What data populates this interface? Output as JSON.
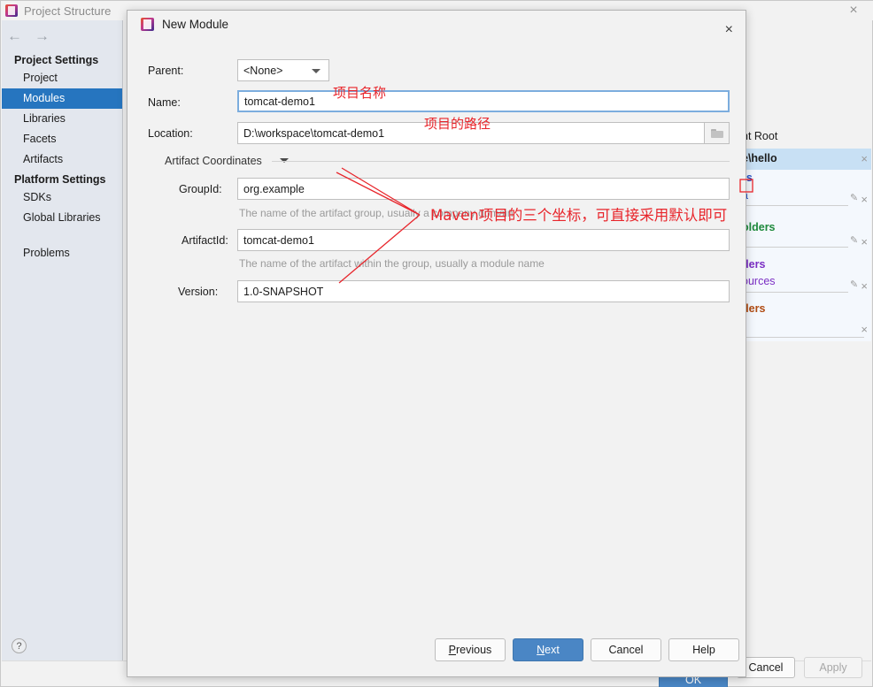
{
  "background_window": {
    "title": "Project Structure",
    "title_icon": "intellij-idea-icon",
    "close_icon": "×",
    "nav_back_icon": "←",
    "nav_forward_icon": "→",
    "help_icon": "?",
    "sidebar": {
      "sections": [
        {
          "label": "Project Settings",
          "items": [
            {
              "label": "Project",
              "selected": false
            },
            {
              "label": "Modules",
              "selected": true
            },
            {
              "label": "Libraries",
              "selected": false
            },
            {
              "label": "Facets",
              "selected": false
            },
            {
              "label": "Artifacts",
              "selected": false
            }
          ]
        },
        {
          "label": "Platform Settings",
          "items": [
            {
              "label": "SDKs",
              "selected": false
            },
            {
              "label": "Global Libraries",
              "selected": false
            }
          ]
        }
      ],
      "extra_items": [
        {
          "label": "Problems",
          "selected": false
        }
      ]
    },
    "right_panel": {
      "content_root_header": "nt Root",
      "selected_path": "e\\hello",
      "groups": [
        {
          "label": "rs",
          "value": "a",
          "color": "#2653c9"
        },
        {
          "label": "olders",
          "value": "",
          "color": "#1e8a3c"
        },
        {
          "label": "ders",
          "value": "ources",
          "color": "#7b2fc4"
        },
        {
          "label": "ders",
          "value": "",
          "color": "#b04b12"
        }
      ],
      "remove_icon": "×",
      "edit_icon": "✎"
    },
    "buttons": {
      "ok": "OK",
      "cancel": "Cancel",
      "apply": "Apply"
    }
  },
  "dialog": {
    "title": "New Module",
    "title_icon": "intellij-idea-icon",
    "close_icon": "×",
    "fields": {
      "parent": {
        "label": "Parent:",
        "value": "<None>"
      },
      "name": {
        "label": "Name:",
        "value": "tomcat-demo1"
      },
      "location": {
        "label": "Location:",
        "value": "D:\\workspace\\tomcat-demo1",
        "browse_icon": "folder-icon"
      }
    },
    "artifact_coordinates": {
      "header": "Artifact Coordinates",
      "expanded": true,
      "group_id": {
        "label": "GroupId:",
        "value": "org.example",
        "hint": "The name of the artifact group, usually a company domain"
      },
      "artifact_id": {
        "label": "ArtifactId:",
        "value": "tomcat-demo1",
        "hint": "The name of the artifact within the group, usually a module name"
      },
      "version": {
        "label": "Version:",
        "value": "1.0-SNAPSHOT",
        "hint": ""
      }
    },
    "buttons": {
      "previous": "Previous",
      "previous_mnemonic": "P",
      "next": "Next",
      "next_mnemonic": "N",
      "cancel": "Cancel",
      "help": "Help"
    }
  },
  "annotations": {
    "color": "#e8252b",
    "name_note": "项目名称",
    "location_note": "项目的路径",
    "coordinates_note": "Maven项目的三个坐标，可直接采用默认即可"
  }
}
